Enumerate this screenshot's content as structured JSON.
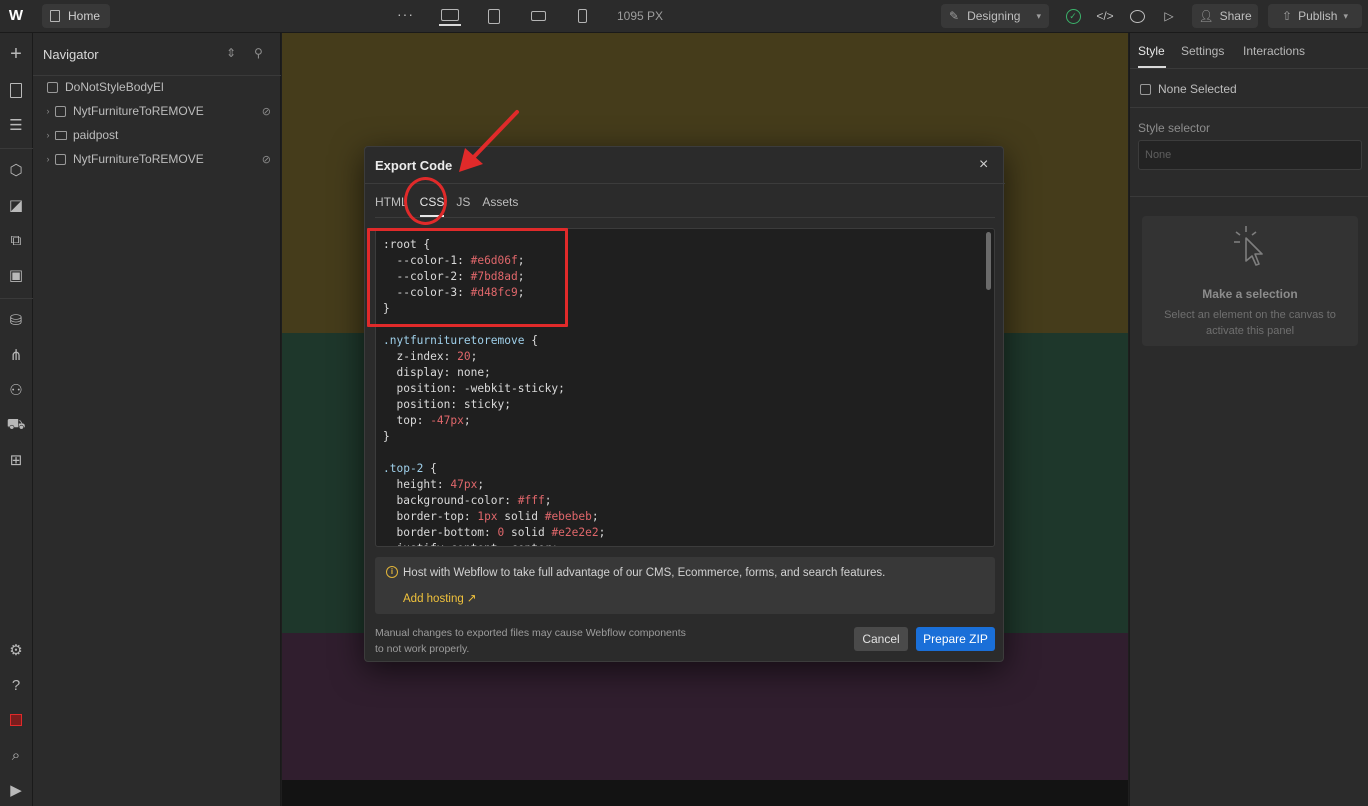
{
  "topbar": {
    "logo": "W",
    "home_label": "Home",
    "more_label": "···",
    "width_label": "1095 PX",
    "mode_label": "Designing",
    "share_label": "Share",
    "publish_label": "Publish"
  },
  "rail": {
    "icons": [
      "add-icon",
      "pages-icon",
      "navigator-icon",
      "components-icon",
      "style-guide-icon",
      "variables-icon",
      "assets-icon",
      "cms-icon",
      "logic-icon",
      "users-icon",
      "ecommerce-icon",
      "apps-icon",
      "settings-icon",
      "help-icon",
      "record-icon",
      "search-icon",
      "video-icon"
    ]
  },
  "navigator": {
    "title": "Navigator",
    "items": [
      {
        "label": "DoNotStyleBodyEl",
        "type": "body"
      },
      {
        "label": "NytFurnitureToREMOVE",
        "type": "div",
        "hidden": true
      },
      {
        "label": "paidpost",
        "type": "folder"
      },
      {
        "label": "NytFurnitureToREMOVE",
        "type": "div",
        "hidden": true
      }
    ]
  },
  "canvas": {
    "band_colors": [
      "#6a5c2a",
      "#2f5543",
      "#4a2e47"
    ]
  },
  "right_panel": {
    "tabs": [
      "Style",
      "Settings",
      "Interactions"
    ],
    "active_tab": "Style",
    "none_selected": "None Selected",
    "style_selector_label": "Style selector",
    "style_selector_placeholder": "None",
    "empty_title": "Make a selection",
    "empty_desc": "Select an element on the canvas to activate this panel"
  },
  "modal": {
    "title": "Export Code",
    "close_label": "×",
    "tabs": [
      "HTML",
      "CSS",
      "JS",
      "Assets"
    ],
    "active_tab": "CSS",
    "code_lines": [
      ":root {",
      "  --color-1: #e6d06f;",
      "  --color-2: #7bd8ad;",
      "  --color-3: #d48fc9;",
      "}",
      "",
      ".nytfurnituretoremove {",
      "  z-index: 20;",
      "  display: none;",
      "  position: -webkit-sticky;",
      "  position: sticky;",
      "  top: -47px;",
      "}",
      "",
      ".top-2 {",
      "  height: 47px;",
      "  background-color: #fff;",
      "  border-top: 1px solid #ebebeb;",
      "  border-bottom: 0 solid #e2e2e2;",
      "  justify-content: center;"
    ],
    "hosting_text": "Host with Webflow to take full advantage of our CMS, Ecommerce, forms, and search features.",
    "hosting_link": "Add hosting ↗",
    "footer_note": "Manual changes to exported files may cause Webflow components to not work properly.",
    "cancel_label": "Cancel",
    "zip_label": "Prepare ZIP"
  },
  "colors": {
    "accent_blue": "#1a6fd8",
    "annotation_red": "#e02a2a",
    "link_yellow": "#f0c23c"
  }
}
